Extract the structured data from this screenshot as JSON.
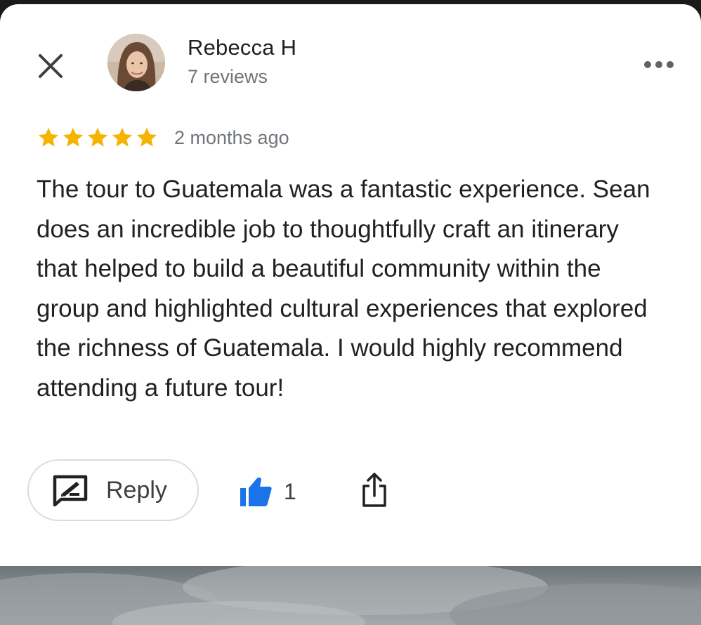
{
  "reviewer": {
    "name": "Rebecca H",
    "reviews_count": "7 reviews"
  },
  "review": {
    "rating": 5,
    "max_rating": 5,
    "time_ago": "2 months ago",
    "text": "The tour to Guatemala was a fantastic experience. Sean does an incredible job to thoughtfully craft an itinerary that helped to build a beautiful community within the group and highlighted cultural experiences that explored the richness of Guatemala. I would highly recommend attending a future tour!"
  },
  "actions": {
    "reply_label": "Reply",
    "like_count": "1"
  },
  "icons": {
    "close": "close-icon",
    "more": "more-horizontal-icon",
    "star": "star-icon",
    "reply": "reply-icon",
    "like": "thumbs-up-icon",
    "share": "share-icon"
  },
  "colors": {
    "star": "#f4b400",
    "like": "#1a73e8",
    "text_primary": "#202124",
    "text_secondary": "#70757a"
  }
}
